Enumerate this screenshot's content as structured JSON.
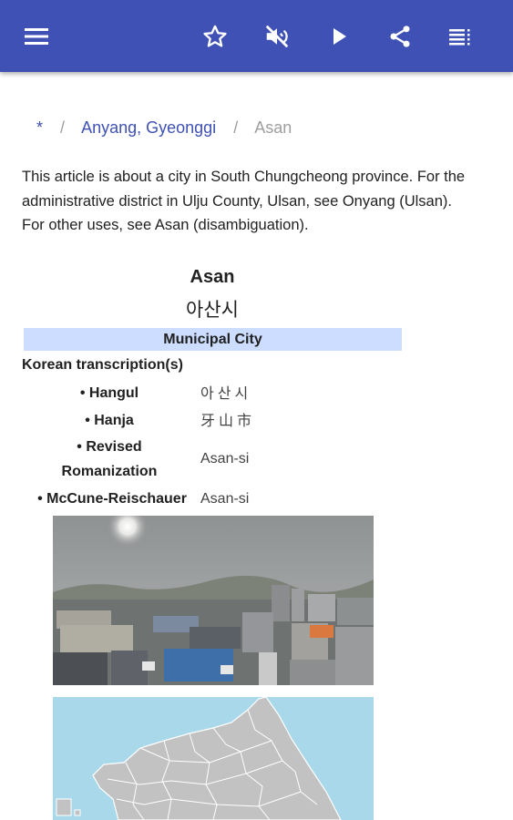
{
  "toolbar": {
    "menu_icon": "menu-icon",
    "bookmark_icon": "star-outline-icon",
    "mute_icon": "volume-off-icon",
    "play_icon": "play-icon",
    "share_icon": "share-icon",
    "contents_icon": "table-of-contents-icon",
    "background_color": "#3f51b5"
  },
  "breadcrumb": {
    "home": "*",
    "separator": "/",
    "parent": "Anyang, Gyeonggi",
    "current": "Asan"
  },
  "hatnote": {
    "line1": "This article is about a city in South Chungcheong province. For the administrative district in Ulju County, Ulsan, see Onyang (Ulsan).",
    "line2": "For other uses, see Asan (disambiguation)."
  },
  "infobox": {
    "title": "Asan",
    "native_name": "아산시",
    "type": "Municipal City",
    "type_background": "#ccddff",
    "transcription_header": "Korean transcription(s)",
    "rows": [
      {
        "label": "• Hangul",
        "value": "아산시"
      },
      {
        "label": "• Hanja",
        "value": "牙山市"
      },
      {
        "label_line1": "• Revised",
        "label_line2": "Romanization",
        "value": "Asan-si"
      },
      {
        "label": "• McCune-Reischauer",
        "value": "Asan-si"
      }
    ]
  }
}
